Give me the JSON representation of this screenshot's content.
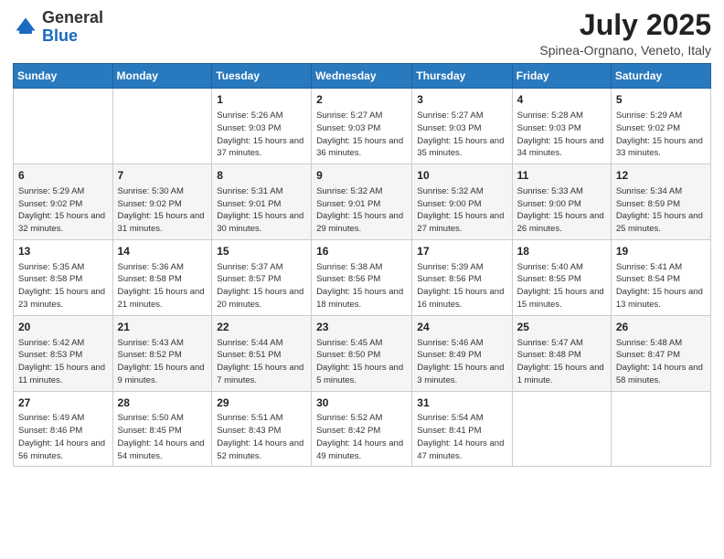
{
  "header": {
    "logo_general": "General",
    "logo_blue": "Blue",
    "title": "July 2025",
    "location": "Spinea-Orgnano, Veneto, Italy"
  },
  "weekdays": [
    "Sunday",
    "Monday",
    "Tuesday",
    "Wednesday",
    "Thursday",
    "Friday",
    "Saturday"
  ],
  "weeks": [
    [
      {
        "day": "",
        "sunrise": "",
        "sunset": "",
        "daylight": ""
      },
      {
        "day": "",
        "sunrise": "",
        "sunset": "",
        "daylight": ""
      },
      {
        "day": "1",
        "sunrise": "Sunrise: 5:26 AM",
        "sunset": "Sunset: 9:03 PM",
        "daylight": "Daylight: 15 hours and 37 minutes."
      },
      {
        "day": "2",
        "sunrise": "Sunrise: 5:27 AM",
        "sunset": "Sunset: 9:03 PM",
        "daylight": "Daylight: 15 hours and 36 minutes."
      },
      {
        "day": "3",
        "sunrise": "Sunrise: 5:27 AM",
        "sunset": "Sunset: 9:03 PM",
        "daylight": "Daylight: 15 hours and 35 minutes."
      },
      {
        "day": "4",
        "sunrise": "Sunrise: 5:28 AM",
        "sunset": "Sunset: 9:03 PM",
        "daylight": "Daylight: 15 hours and 34 minutes."
      },
      {
        "day": "5",
        "sunrise": "Sunrise: 5:29 AM",
        "sunset": "Sunset: 9:02 PM",
        "daylight": "Daylight: 15 hours and 33 minutes."
      }
    ],
    [
      {
        "day": "6",
        "sunrise": "Sunrise: 5:29 AM",
        "sunset": "Sunset: 9:02 PM",
        "daylight": "Daylight: 15 hours and 32 minutes."
      },
      {
        "day": "7",
        "sunrise": "Sunrise: 5:30 AM",
        "sunset": "Sunset: 9:02 PM",
        "daylight": "Daylight: 15 hours and 31 minutes."
      },
      {
        "day": "8",
        "sunrise": "Sunrise: 5:31 AM",
        "sunset": "Sunset: 9:01 PM",
        "daylight": "Daylight: 15 hours and 30 minutes."
      },
      {
        "day": "9",
        "sunrise": "Sunrise: 5:32 AM",
        "sunset": "Sunset: 9:01 PM",
        "daylight": "Daylight: 15 hours and 29 minutes."
      },
      {
        "day": "10",
        "sunrise": "Sunrise: 5:32 AM",
        "sunset": "Sunset: 9:00 PM",
        "daylight": "Daylight: 15 hours and 27 minutes."
      },
      {
        "day": "11",
        "sunrise": "Sunrise: 5:33 AM",
        "sunset": "Sunset: 9:00 PM",
        "daylight": "Daylight: 15 hours and 26 minutes."
      },
      {
        "day": "12",
        "sunrise": "Sunrise: 5:34 AM",
        "sunset": "Sunset: 8:59 PM",
        "daylight": "Daylight: 15 hours and 25 minutes."
      }
    ],
    [
      {
        "day": "13",
        "sunrise": "Sunrise: 5:35 AM",
        "sunset": "Sunset: 8:58 PM",
        "daylight": "Daylight: 15 hours and 23 minutes."
      },
      {
        "day": "14",
        "sunrise": "Sunrise: 5:36 AM",
        "sunset": "Sunset: 8:58 PM",
        "daylight": "Daylight: 15 hours and 21 minutes."
      },
      {
        "day": "15",
        "sunrise": "Sunrise: 5:37 AM",
        "sunset": "Sunset: 8:57 PM",
        "daylight": "Daylight: 15 hours and 20 minutes."
      },
      {
        "day": "16",
        "sunrise": "Sunrise: 5:38 AM",
        "sunset": "Sunset: 8:56 PM",
        "daylight": "Daylight: 15 hours and 18 minutes."
      },
      {
        "day": "17",
        "sunrise": "Sunrise: 5:39 AM",
        "sunset": "Sunset: 8:56 PM",
        "daylight": "Daylight: 15 hours and 16 minutes."
      },
      {
        "day": "18",
        "sunrise": "Sunrise: 5:40 AM",
        "sunset": "Sunset: 8:55 PM",
        "daylight": "Daylight: 15 hours and 15 minutes."
      },
      {
        "day": "19",
        "sunrise": "Sunrise: 5:41 AM",
        "sunset": "Sunset: 8:54 PM",
        "daylight": "Daylight: 15 hours and 13 minutes."
      }
    ],
    [
      {
        "day": "20",
        "sunrise": "Sunrise: 5:42 AM",
        "sunset": "Sunset: 8:53 PM",
        "daylight": "Daylight: 15 hours and 11 minutes."
      },
      {
        "day": "21",
        "sunrise": "Sunrise: 5:43 AM",
        "sunset": "Sunset: 8:52 PM",
        "daylight": "Daylight: 15 hours and 9 minutes."
      },
      {
        "day": "22",
        "sunrise": "Sunrise: 5:44 AM",
        "sunset": "Sunset: 8:51 PM",
        "daylight": "Daylight: 15 hours and 7 minutes."
      },
      {
        "day": "23",
        "sunrise": "Sunrise: 5:45 AM",
        "sunset": "Sunset: 8:50 PM",
        "daylight": "Daylight: 15 hours and 5 minutes."
      },
      {
        "day": "24",
        "sunrise": "Sunrise: 5:46 AM",
        "sunset": "Sunset: 8:49 PM",
        "daylight": "Daylight: 15 hours and 3 minutes."
      },
      {
        "day": "25",
        "sunrise": "Sunrise: 5:47 AM",
        "sunset": "Sunset: 8:48 PM",
        "daylight": "Daylight: 15 hours and 1 minute."
      },
      {
        "day": "26",
        "sunrise": "Sunrise: 5:48 AM",
        "sunset": "Sunset: 8:47 PM",
        "daylight": "Daylight: 14 hours and 58 minutes."
      }
    ],
    [
      {
        "day": "27",
        "sunrise": "Sunrise: 5:49 AM",
        "sunset": "Sunset: 8:46 PM",
        "daylight": "Daylight: 14 hours and 56 minutes."
      },
      {
        "day": "28",
        "sunrise": "Sunrise: 5:50 AM",
        "sunset": "Sunset: 8:45 PM",
        "daylight": "Daylight: 14 hours and 54 minutes."
      },
      {
        "day": "29",
        "sunrise": "Sunrise: 5:51 AM",
        "sunset": "Sunset: 8:43 PM",
        "daylight": "Daylight: 14 hours and 52 minutes."
      },
      {
        "day": "30",
        "sunrise": "Sunrise: 5:52 AM",
        "sunset": "Sunset: 8:42 PM",
        "daylight": "Daylight: 14 hours and 49 minutes."
      },
      {
        "day": "31",
        "sunrise": "Sunrise: 5:54 AM",
        "sunset": "Sunset: 8:41 PM",
        "daylight": "Daylight: 14 hours and 47 minutes."
      },
      {
        "day": "",
        "sunrise": "",
        "sunset": "",
        "daylight": ""
      },
      {
        "day": "",
        "sunrise": "",
        "sunset": "",
        "daylight": ""
      }
    ]
  ]
}
